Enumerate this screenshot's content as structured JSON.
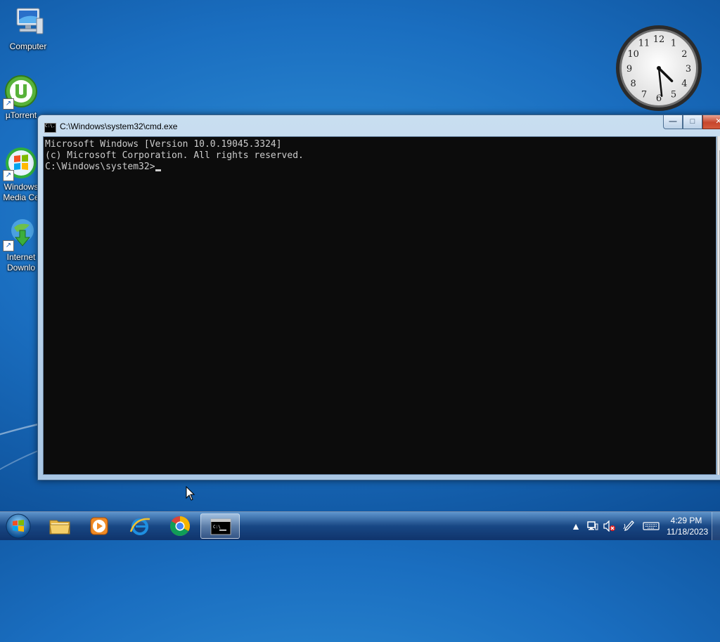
{
  "desktop": {
    "icons": [
      {
        "label": "Computer"
      },
      {
        "label": "µTorrent"
      },
      {
        "label": "Windows\nMedia Ce"
      },
      {
        "label": "Internet\nDownlo"
      }
    ]
  },
  "clock_gadget": {
    "numbers": [
      "12",
      "1",
      "2",
      "3",
      "4",
      "5",
      "6",
      "7",
      "8",
      "9",
      "10",
      "11"
    ],
    "hour": 4,
    "minute": 29
  },
  "window": {
    "title": "C:\\Windows\\system32\\cmd.exe",
    "title_icon_text": "C:\\.",
    "minimize_label": "—",
    "maximize_label": "□",
    "close_label": "✕",
    "console": {
      "line1": "Microsoft Windows [Version 10.0.19045.3324]",
      "line2": "(c) Microsoft Corporation. All rights reserved.",
      "line3": "",
      "prompt": "C:\\Windows\\system32>"
    }
  },
  "taskbar": {
    "pinned": [
      {
        "name": "Windows Explorer",
        "icon": "folder-icon"
      },
      {
        "name": "Windows Media Player",
        "icon": "media-player-icon"
      },
      {
        "name": "Internet Explorer",
        "icon": "ie-icon"
      },
      {
        "name": "Google Chrome",
        "icon": "chrome-icon"
      },
      {
        "name": "Command Prompt",
        "icon": "cmd-icon",
        "active": true
      }
    ],
    "tray": {
      "icons": [
        "show-hidden-icons-arrow",
        "network-icon",
        "volume-muted-icon",
        "pen-input-icon",
        "keyboard-icon"
      ],
      "time": "4:29 PM",
      "date": "11/18/2023"
    }
  },
  "colors": {
    "console_bg": "#0c0c0c",
    "console_fg": "#cccccc",
    "close_button": "#c7462c"
  }
}
